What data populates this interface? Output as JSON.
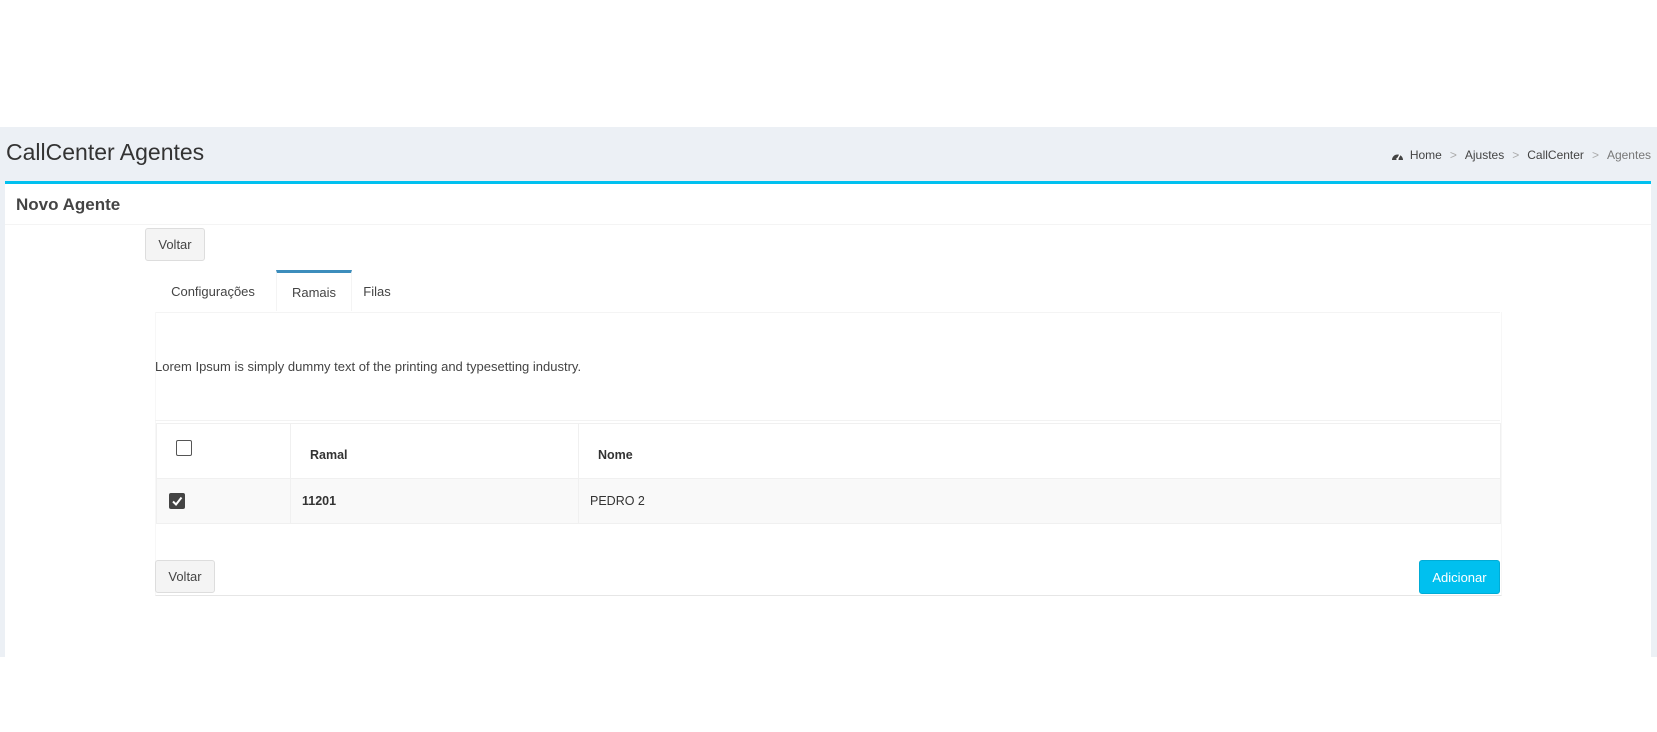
{
  "header": {
    "title": "CallCenter Agentes",
    "breadcrumb": {
      "home_icon": "dashboard-gauge-icon",
      "home": "Home",
      "separator": ">",
      "ajustes": "Ajustes",
      "callcenter": "CallCenter",
      "current": "Agentes"
    }
  },
  "box": {
    "title": "Novo Agente",
    "accent_color": "#00c0ef"
  },
  "buttons": {
    "voltar_top": "Voltar",
    "voltar_bottom": "Voltar",
    "adicionar": "Adicionar"
  },
  "tabs": [
    {
      "label": "Configurações",
      "active": false
    },
    {
      "label": "Ramais",
      "active": true
    },
    {
      "label": "Filas",
      "active": false
    }
  ],
  "description": "Lorem Ipsum is simply dummy text of the printing and typesetting industry.",
  "table": {
    "headers": {
      "ramal": "Ramal",
      "nome": "Nome"
    },
    "select_all_checked": false,
    "rows": [
      {
        "checked": true,
        "ramal": "11201",
        "nome": "PEDRO 2"
      }
    ]
  }
}
